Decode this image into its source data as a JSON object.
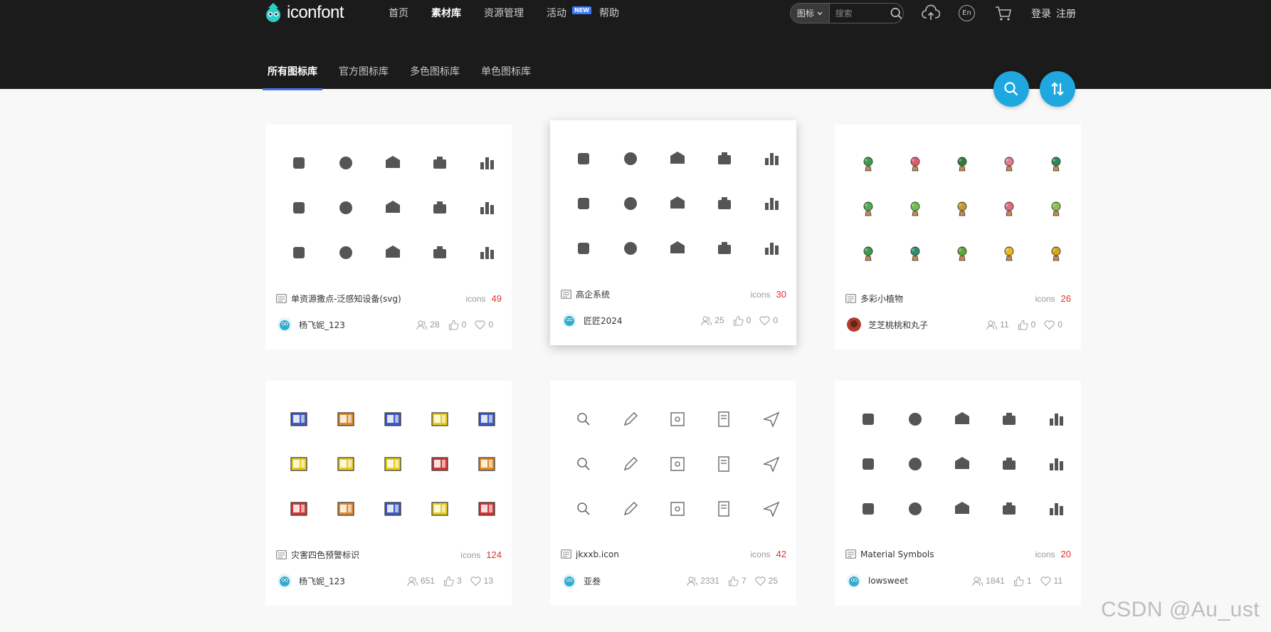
{
  "header": {
    "logo_text": "iconfont",
    "nav": [
      {
        "label": "首页"
      },
      {
        "label": "素材库",
        "active": true
      },
      {
        "label": "资源管理"
      },
      {
        "label": "活动",
        "badge": "NEW"
      },
      {
        "label": "帮助"
      }
    ],
    "search": {
      "type": "图标",
      "placeholder": "搜索"
    },
    "lang": "En",
    "login": "登录",
    "register": "注册"
  },
  "subnav": [
    {
      "label": "所有图标库",
      "active": true
    },
    {
      "label": "官方图标库"
    },
    {
      "label": "多色图标库"
    },
    {
      "label": "单色图标库"
    }
  ],
  "icons_label": "icons",
  "cards": [
    {
      "title": "单资源撒点-泛感知设备(svg)",
      "count": "49",
      "author": "杨飞妮_123",
      "users": "28",
      "likes": "0",
      "favorites": "0",
      "style": "mono-gray",
      "avatar": "blue"
    },
    {
      "title": "高企系统",
      "count": "30",
      "author": "匠匠2024",
      "users": "25",
      "likes": "0",
      "favorites": "0",
      "style": "mono-gray",
      "avatar": "blue",
      "raised": true
    },
    {
      "title": "多彩小植物",
      "count": "26",
      "author": "芝芝桃桃和丸子",
      "users": "11",
      "likes": "0",
      "favorites": "0",
      "style": "plant",
      "avatar": "red"
    },
    {
      "title": "灾害四色预警标识",
      "count": "124",
      "author": "杨飞妮_123",
      "users": "651",
      "likes": "3",
      "favorites": "13",
      "style": "warning",
      "avatar": "blue"
    },
    {
      "title": "jkxxb.icon",
      "count": "42",
      "author": "亚叁",
      "users": "2331",
      "likes": "7",
      "favorites": "25",
      "style": "outline",
      "avatar": "blue"
    },
    {
      "title": "Material Symbols",
      "count": "20",
      "author": "lowsweet",
      "users": "1841",
      "likes": "1",
      "favorites": "11",
      "style": "material",
      "avatar": "blue"
    }
  ],
  "watermark": "CSDN @Au_ust",
  "colors": {
    "header_bg": "#1b1b1b",
    "accent": "#1fa8e0",
    "count_red": "#e23030",
    "tab_underline": "#4a72e8"
  }
}
